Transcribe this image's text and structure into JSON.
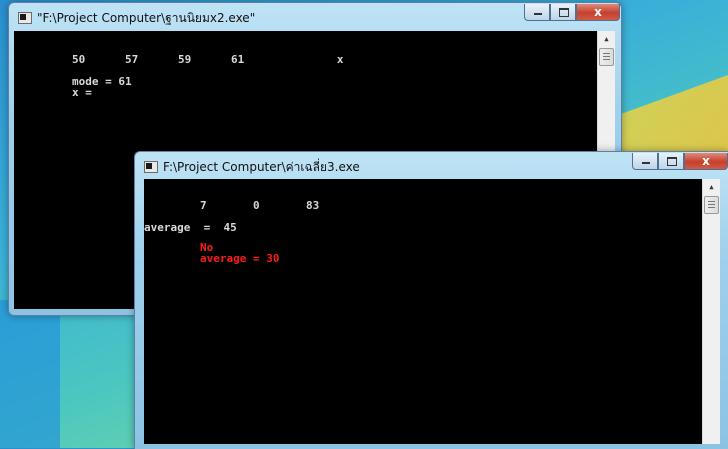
{
  "window1": {
    "title": "\"F:\\Project Computer\\ฐานนิยมx2.exe\"",
    "lines": [
      "50      57      59      61              x",
      "mode = 61",
      "x ="
    ]
  },
  "window2": {
    "title": "F:\\Project Computer\\ค่าเฉลี่ย3.exe",
    "lines": [
      "7       0       83",
      "average  =  45",
      "No",
      "average = 30"
    ]
  },
  "controls": {
    "close": "x"
  },
  "scroll_up_glyph": "▲",
  "colors": {
    "console_bg": "#000000",
    "console_text": "#d8d8d8",
    "error_text": "#ff1a1a"
  }
}
